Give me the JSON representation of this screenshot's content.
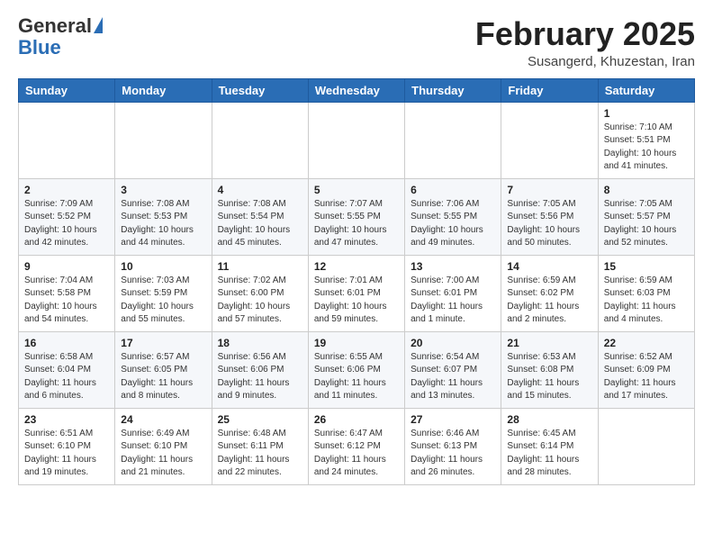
{
  "logo": {
    "general": "General",
    "blue": "Blue"
  },
  "header": {
    "title": "February 2025",
    "subtitle": "Susangerd, Khuzestan, Iran"
  },
  "weekdays": [
    "Sunday",
    "Monday",
    "Tuesday",
    "Wednesday",
    "Thursday",
    "Friday",
    "Saturday"
  ],
  "weeks": [
    [
      {
        "day": "",
        "info": ""
      },
      {
        "day": "",
        "info": ""
      },
      {
        "day": "",
        "info": ""
      },
      {
        "day": "",
        "info": ""
      },
      {
        "day": "",
        "info": ""
      },
      {
        "day": "",
        "info": ""
      },
      {
        "day": "1",
        "info": "Sunrise: 7:10 AM\nSunset: 5:51 PM\nDaylight: 10 hours and 41 minutes."
      }
    ],
    [
      {
        "day": "2",
        "info": "Sunrise: 7:09 AM\nSunset: 5:52 PM\nDaylight: 10 hours and 42 minutes."
      },
      {
        "day": "3",
        "info": "Sunrise: 7:08 AM\nSunset: 5:53 PM\nDaylight: 10 hours and 44 minutes."
      },
      {
        "day": "4",
        "info": "Sunrise: 7:08 AM\nSunset: 5:54 PM\nDaylight: 10 hours and 45 minutes."
      },
      {
        "day": "5",
        "info": "Sunrise: 7:07 AM\nSunset: 5:55 PM\nDaylight: 10 hours and 47 minutes."
      },
      {
        "day": "6",
        "info": "Sunrise: 7:06 AM\nSunset: 5:55 PM\nDaylight: 10 hours and 49 minutes."
      },
      {
        "day": "7",
        "info": "Sunrise: 7:05 AM\nSunset: 5:56 PM\nDaylight: 10 hours and 50 minutes."
      },
      {
        "day": "8",
        "info": "Sunrise: 7:05 AM\nSunset: 5:57 PM\nDaylight: 10 hours and 52 minutes."
      }
    ],
    [
      {
        "day": "9",
        "info": "Sunrise: 7:04 AM\nSunset: 5:58 PM\nDaylight: 10 hours and 54 minutes."
      },
      {
        "day": "10",
        "info": "Sunrise: 7:03 AM\nSunset: 5:59 PM\nDaylight: 10 hours and 55 minutes."
      },
      {
        "day": "11",
        "info": "Sunrise: 7:02 AM\nSunset: 6:00 PM\nDaylight: 10 hours and 57 minutes."
      },
      {
        "day": "12",
        "info": "Sunrise: 7:01 AM\nSunset: 6:01 PM\nDaylight: 10 hours and 59 minutes."
      },
      {
        "day": "13",
        "info": "Sunrise: 7:00 AM\nSunset: 6:01 PM\nDaylight: 11 hours and 1 minute."
      },
      {
        "day": "14",
        "info": "Sunrise: 6:59 AM\nSunset: 6:02 PM\nDaylight: 11 hours and 2 minutes."
      },
      {
        "day": "15",
        "info": "Sunrise: 6:59 AM\nSunset: 6:03 PM\nDaylight: 11 hours and 4 minutes."
      }
    ],
    [
      {
        "day": "16",
        "info": "Sunrise: 6:58 AM\nSunset: 6:04 PM\nDaylight: 11 hours and 6 minutes."
      },
      {
        "day": "17",
        "info": "Sunrise: 6:57 AM\nSunset: 6:05 PM\nDaylight: 11 hours and 8 minutes."
      },
      {
        "day": "18",
        "info": "Sunrise: 6:56 AM\nSunset: 6:06 PM\nDaylight: 11 hours and 9 minutes."
      },
      {
        "day": "19",
        "info": "Sunrise: 6:55 AM\nSunset: 6:06 PM\nDaylight: 11 hours and 11 minutes."
      },
      {
        "day": "20",
        "info": "Sunrise: 6:54 AM\nSunset: 6:07 PM\nDaylight: 11 hours and 13 minutes."
      },
      {
        "day": "21",
        "info": "Sunrise: 6:53 AM\nSunset: 6:08 PM\nDaylight: 11 hours and 15 minutes."
      },
      {
        "day": "22",
        "info": "Sunrise: 6:52 AM\nSunset: 6:09 PM\nDaylight: 11 hours and 17 minutes."
      }
    ],
    [
      {
        "day": "23",
        "info": "Sunrise: 6:51 AM\nSunset: 6:10 PM\nDaylight: 11 hours and 19 minutes."
      },
      {
        "day": "24",
        "info": "Sunrise: 6:49 AM\nSunset: 6:10 PM\nDaylight: 11 hours and 21 minutes."
      },
      {
        "day": "25",
        "info": "Sunrise: 6:48 AM\nSunset: 6:11 PM\nDaylight: 11 hours and 22 minutes."
      },
      {
        "day": "26",
        "info": "Sunrise: 6:47 AM\nSunset: 6:12 PM\nDaylight: 11 hours and 24 minutes."
      },
      {
        "day": "27",
        "info": "Sunrise: 6:46 AM\nSunset: 6:13 PM\nDaylight: 11 hours and 26 minutes."
      },
      {
        "day": "28",
        "info": "Sunrise: 6:45 AM\nSunset: 6:14 PM\nDaylight: 11 hours and 28 minutes."
      },
      {
        "day": "",
        "info": ""
      }
    ]
  ]
}
